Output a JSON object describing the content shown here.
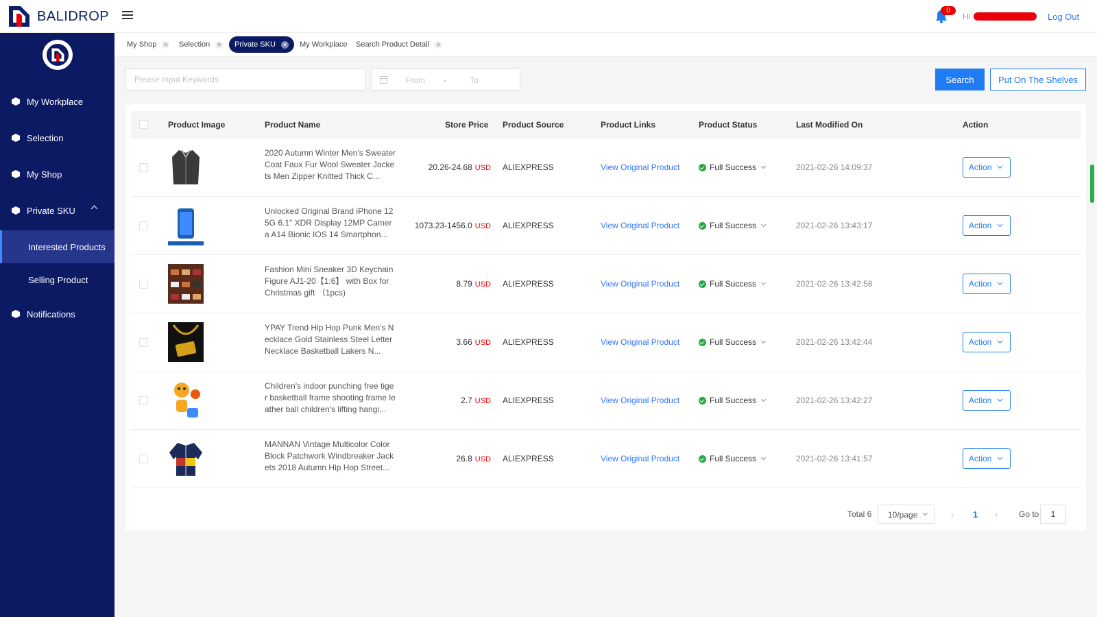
{
  "app": {
    "brand": "BALIDROP"
  },
  "header": {
    "notification_count": "0",
    "greeting": "Hi",
    "logout_label": "Log Out"
  },
  "sidebar": {
    "items": [
      {
        "label": "My Workplace"
      },
      {
        "label": "Selection"
      },
      {
        "label": "My Shop"
      },
      {
        "label": "Private SKU"
      },
      {
        "label": "Interested Products"
      },
      {
        "label": "Selling Product"
      },
      {
        "label": "Notifications"
      }
    ]
  },
  "tabs": [
    {
      "label": "My Shop",
      "closable": true
    },
    {
      "label": "Selection",
      "closable": true
    },
    {
      "label": "Private SKU",
      "closable": true,
      "active": true
    },
    {
      "label": "My Workplace",
      "closable": false
    },
    {
      "label": "Search Product Detail",
      "closable": true
    }
  ],
  "filters": {
    "keyword_placeholder": "Please Input Keywords",
    "date_from_placeholder": "From",
    "date_sep": "-",
    "date_to_placeholder": "To",
    "search_label": "Search",
    "shelves_label": "Put On The Shelves"
  },
  "table": {
    "columns": [
      "Product Image",
      "Product Name",
      "Store Price",
      "Product Source",
      "Product Links",
      "Product Status",
      "Last Modified On",
      "Action"
    ],
    "rows": [
      {
        "name": "2020 Autumn Winter Men's Sweater Coat Faux Fur Wool Sweater Jackets Men Zipper Knitted Thick C...",
        "price": "20.26-24.68",
        "currency": "USD",
        "source": "ALIEXPRESS",
        "link": "View Original Product",
        "status": "Full Success",
        "modified": "2021-02-26 14:09:37",
        "action": "Action"
      },
      {
        "name": "Unlocked Original Brand iPhone 12 5G 6.1\" XDR Display 12MP Camera A14 Bionic IOS 14 Smartphon...",
        "price": "1073.23-1456.0",
        "currency": "USD",
        "source": "ALIEXPRESS",
        "link": "View Original Product",
        "status": "Full Success",
        "modified": "2021-02-26 13:43:17",
        "action": "Action"
      },
      {
        "name": "Fashion Mini Sneaker 3D Keychain Figure AJ1-20【1:6】 with Box for Christmas gift （1pcs)",
        "price": "8.79",
        "currency": "USD",
        "source": "ALIEXPRESS",
        "link": "View Original Product",
        "status": "Full Success",
        "modified": "2021-02-26 13:42:58",
        "action": "Action"
      },
      {
        "name": "YPAY Trend Hip Hop Punk Men's Necklace Gold Stainless Steel Letter Necklace Basketball Lakers N...",
        "price": "3.66",
        "currency": "USD",
        "source": "ALIEXPRESS",
        "link": "View Original Product",
        "status": "Full Success",
        "modified": "2021-02-26 13:42:44",
        "action": "Action"
      },
      {
        "name": "Children's indoor punching free tiger basketball frame shooting frame leather ball children's lifting hangi...",
        "price": "2.7",
        "currency": "USD",
        "source": "ALIEXPRESS",
        "link": "View Original Product",
        "status": "Full Success",
        "modified": "2021-02-26 13:42:27",
        "action": "Action"
      },
      {
        "name": "MANNAN Vintage Multicolor Color Block Patchwork Windbreaker Jackets 2018 Autumn Hip Hop Street...",
        "price": "26.8",
        "currency": "USD",
        "source": "ALIEXPRESS",
        "link": "View Original Product",
        "status": "Full Success",
        "modified": "2021-02-26 13:41:57",
        "action": "Action"
      }
    ]
  },
  "pagination": {
    "total_label": "Total 6",
    "page_size": "10/page",
    "prev": "‹",
    "current_page": "1",
    "next": "›",
    "goto_label": "Go to",
    "goto_value": "1"
  },
  "colors": {
    "sidebar_bg": "#0b1a63",
    "primary": "#1f7cf4",
    "success": "#27a844",
    "price_currency": "#e8000a"
  }
}
